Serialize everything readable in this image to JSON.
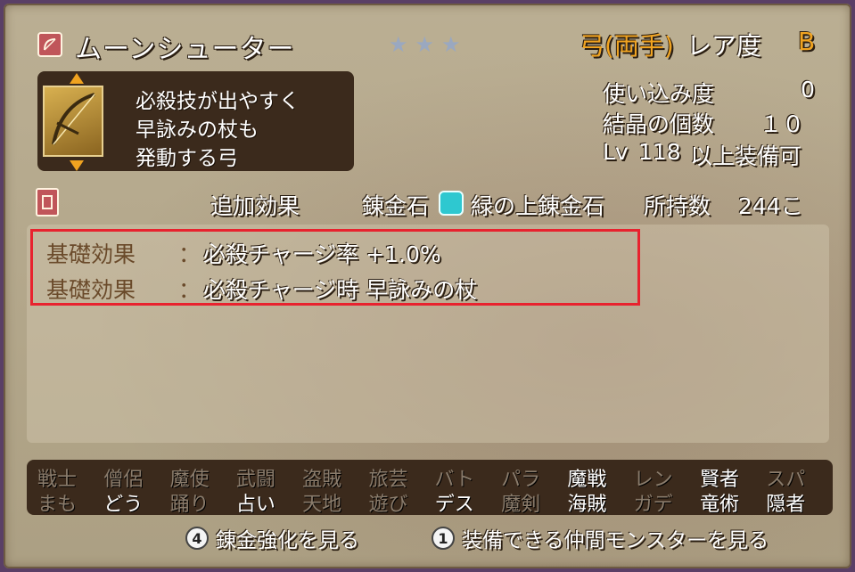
{
  "header": {
    "item_name": "ムーンシューター",
    "stars": [
      "★",
      "★",
      "★"
    ],
    "category": "弓(両手)",
    "rarity_label": "レア度",
    "rarity_value": "B"
  },
  "description": {
    "lines": [
      "必殺技が出やすく",
      "早詠みの杖も",
      "発動する弓"
    ]
  },
  "stats": {
    "usage_label": "使い込み度",
    "usage_value": "0",
    "crystal_label": "結晶の個数",
    "crystal_value": "１０",
    "level_prefix": "Lv",
    "level_value": "118",
    "level_suffix": "以上装備可"
  },
  "alchemy": {
    "extra_effect_label": "追加効果",
    "stone_label": "錬金石",
    "stone_name": "緑の上錬金石",
    "owned_label": "所持数",
    "owned_value": "244こ"
  },
  "effects": [
    {
      "label": "基礎効果",
      "sep": "：",
      "text": "必殺チャージ率 +1.0%"
    },
    {
      "label": "基礎効果",
      "sep": "：",
      "text": "必殺チャージ時 早詠みの杖"
    }
  ],
  "jobs_row1": [
    {
      "name": "戦士",
      "enabled": false
    },
    {
      "name": "僧侶",
      "enabled": false
    },
    {
      "name": "魔使",
      "enabled": false
    },
    {
      "name": "武闘",
      "enabled": false
    },
    {
      "name": "盗賊",
      "enabled": false
    },
    {
      "name": "旅芸",
      "enabled": false
    },
    {
      "name": "バト",
      "enabled": false
    },
    {
      "name": "パラ",
      "enabled": false
    },
    {
      "name": "魔戦",
      "enabled": true
    },
    {
      "name": "レン",
      "enabled": false
    },
    {
      "name": "賢者",
      "enabled": true
    },
    {
      "name": "スパ",
      "enabled": false
    }
  ],
  "jobs_row2": [
    {
      "name": "まも",
      "enabled": false
    },
    {
      "name": "どう",
      "enabled": true
    },
    {
      "name": "踊り",
      "enabled": false
    },
    {
      "name": "占い",
      "enabled": true
    },
    {
      "name": "天地",
      "enabled": false
    },
    {
      "name": "遊び",
      "enabled": false
    },
    {
      "name": "デス",
      "enabled": true
    },
    {
      "name": "魔剣",
      "enabled": false
    },
    {
      "name": "海賊",
      "enabled": true
    },
    {
      "name": "ガデ",
      "enabled": false
    },
    {
      "name": "竜術",
      "enabled": true
    },
    {
      "name": "隠者",
      "enabled": true
    }
  ],
  "buttons": {
    "alchemy_badge": "4",
    "alchemy_label": "錬金強化を見る",
    "monster_badge": "1",
    "monster_label": "装備できる仲間モンスターを見る"
  },
  "colors": {
    "accent_orange": "#f0a320",
    "highlight_red": "#e8222e",
    "gem_cyan": "#2ec8d0"
  }
}
